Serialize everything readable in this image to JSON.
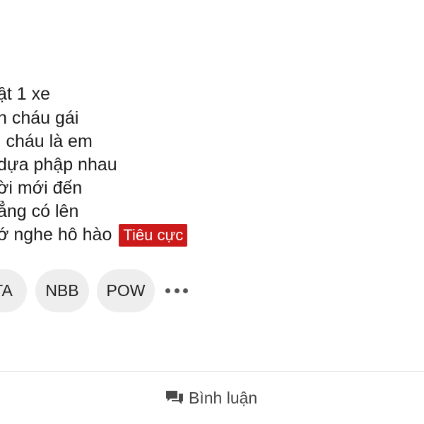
{
  "post": {
    "lines": [
      "ật 1 xe",
      "n cháu gái",
      "i cháu là em",
      "dựa phập nhau",
      "ời mới đến",
      "ẳng có lên",
      "ớ nghe hô hào"
    ],
    "sentiment_tag": "Tiêu cực",
    "sentiment_color": "#cc1a1a"
  },
  "chips": [
    "TA",
    "NBB",
    "POW"
  ],
  "more_icon": "more-horizontal-icon",
  "footer": {
    "comment_icon": "comment-icon",
    "comment_label": "Bình luận"
  }
}
